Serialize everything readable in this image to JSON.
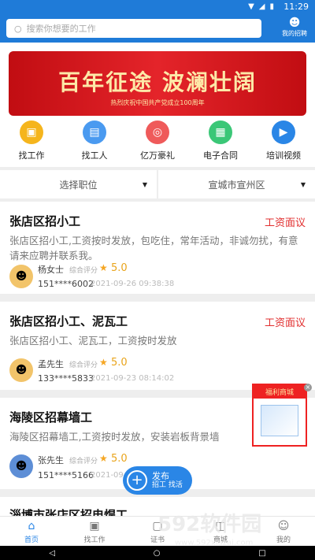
{
  "status": {
    "time": "11:29"
  },
  "search": {
    "placeholder": "搜索你想要的工作"
  },
  "header": {
    "my_recruit": "我的招聘"
  },
  "banner": {
    "main_text": "百年征途 波澜壮阔",
    "sub_text": "热烈庆祝中国共产党成立100周年"
  },
  "nav": {
    "items": [
      {
        "label": "找工作",
        "icon": "briefcase-icon",
        "color": "#f5b51d"
      },
      {
        "label": "找工人",
        "icon": "id-card-icon",
        "color": "#4a9af0"
      },
      {
        "label": "亿万豪礼",
        "icon": "gift-icon",
        "color": "#ef5a5a"
      },
      {
        "label": "电子合同",
        "icon": "contract-icon",
        "color": "#3bc777"
      },
      {
        "label": "培训视频",
        "icon": "video-icon",
        "color": "#2a86e6"
      }
    ]
  },
  "filters": {
    "position": "选择职位",
    "location": "宣城市宣州区"
  },
  "jobs": [
    {
      "title": "张店区招小工",
      "wage": "工资面议",
      "description": "张店区招小工,工资按时发放，包吃住，常年活动，非诚勿扰，有意请来应聘并联系我。",
      "contact": "杨女士",
      "rating_label": "综合评分",
      "score": "5.0",
      "phone": "151****6002",
      "date": "2021-09-26 09:38:38"
    },
    {
      "title": "张店区招小工、泥瓦工",
      "wage": "工资面议",
      "description": "张店区招小工、泥瓦工，工资按时发放",
      "contact": "孟先生",
      "rating_label": "综合评分",
      "score": "5.0",
      "phone": "133****5833",
      "date": "2021-09-23 08:14:02"
    },
    {
      "title": "海陵区招幕墙工",
      "wage": "",
      "description": "海陵区招幕墙工,工资按时发放，安装岩板背景墙",
      "contact": "张先生",
      "rating_label": "综合评分",
      "score": "5.0",
      "phone": "151****5166",
      "date": "2021-09-"
    },
    {
      "title": "淄博市张店区招电焊工",
      "wage": ""
    }
  ],
  "ad": {
    "header": "福利商城"
  },
  "fab": {
    "title": "发布",
    "subtitle": "招工 找活"
  },
  "tabbar": {
    "items": [
      "首页",
      "找工作",
      "证书",
      "商城",
      "我的"
    ]
  },
  "watermark": {
    "text": "592软件园",
    "url": "www.592xiazai.com"
  },
  "colors": {
    "brand": "#1f7bd8",
    "accent": "#e12e2e"
  }
}
